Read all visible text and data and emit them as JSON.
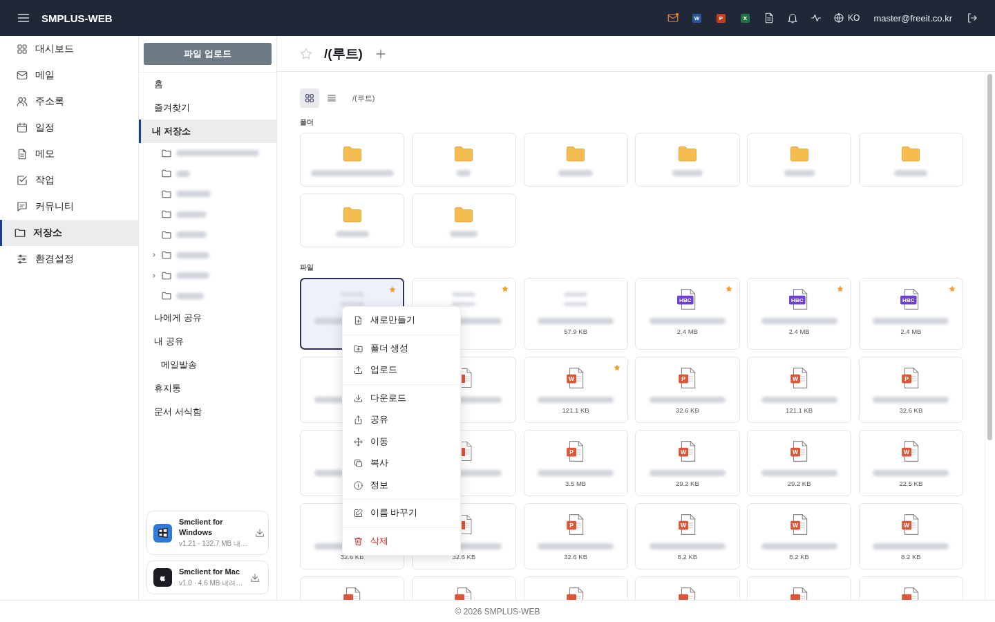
{
  "top_bar": {
    "app_name": "SMPLUS-WEB",
    "office_apps": [
      {
        "letter": "W",
        "color": "#2b579a"
      },
      {
        "letter": "P",
        "color": "#c43e1c"
      },
      {
        "letter": "X",
        "color": "#217346"
      }
    ],
    "language": "KO",
    "user": "master@freeit.co.kr"
  },
  "nav": [
    {
      "label": "대시보드",
      "selected": false
    },
    {
      "label": "메일",
      "selected": false
    },
    {
      "label": "주소록",
      "selected": false
    },
    {
      "label": "일정",
      "selected": false
    },
    {
      "label": "메모",
      "selected": false
    },
    {
      "label": "작업",
      "selected": false
    },
    {
      "label": "커뮤니티",
      "selected": false
    },
    {
      "label": "저장소",
      "selected": true
    },
    {
      "label": "환경설정",
      "selected": false
    }
  ],
  "storage_sidebar": {
    "upload_button": "파일 업로드",
    "items": [
      {
        "label": "홈",
        "selected": false
      },
      {
        "label": "즐겨찾기",
        "selected": false
      },
      {
        "label": "내 저장소",
        "selected": true,
        "children": [
          {
            "expandable": false
          },
          {
            "expandable": false
          },
          {
            "expandable": false
          },
          {
            "expandable": false
          },
          {
            "expandable": false
          },
          {
            "expandable": true
          },
          {
            "expandable": true
          },
          {
            "expandable": false
          }
        ]
      },
      {
        "label": "나에게 공유",
        "selected": false
      },
      {
        "label": "내 공유",
        "selected": false,
        "children": [
          {
            "label": "메일발송",
            "selected": false
          }
        ]
      },
      {
        "label": "휴지통",
        "selected": false
      },
      {
        "label": "문서 서식함",
        "selected": false
      }
    ],
    "apps": [
      {
        "kind": "windows",
        "name": "Smclient for Windows",
        "info": "v1.21 · 132.7 MB 내…"
      },
      {
        "kind": "mac",
        "name": "Smclient for Mac",
        "info": "v1.0 · 4.6 MB 내려…"
      }
    ]
  },
  "header": {
    "title": "/(루트)",
    "favorite": false
  },
  "toolbar": {
    "views": [
      {
        "kind": "grid",
        "selected": true
      },
      {
        "kind": "list",
        "selected": false
      }
    ],
    "breadcrumb": "/(루트)"
  },
  "folders": {
    "heading": "폴더",
    "items": [
      {
        "kind": "folder"
      },
      {
        "kind": "folder"
      },
      {
        "kind": "folder"
      },
      {
        "kind": "folder"
      },
      {
        "kind": "folder"
      },
      {
        "kind": "folder"
      },
      {
        "kind": "folder"
      },
      {
        "kind": "folder"
      }
    ]
  },
  "files": {
    "heading": "파일",
    "items": [
      {
        "kind": "image",
        "starred": true,
        "selected": true
      },
      {
        "kind": "image",
        "starred": true,
        "selected": false
      },
      {
        "kind": "image",
        "starred": false,
        "selected": false,
        "size": "57.9 KB"
      },
      {
        "kind": "hbc",
        "badge": "HBC",
        "starred": true,
        "selected": false,
        "size": "2.4 MB"
      },
      {
        "kind": "hbc",
        "badge": "HBC",
        "starred": true,
        "selected": false,
        "size": "2.4 MB"
      },
      {
        "kind": "hbc",
        "badge": "HBC",
        "starred": true,
        "selected": false,
        "size": "2.4 MB"
      },
      {
        "kind": "covered",
        "starred": false,
        "selected": false
      },
      {
        "kind": "doc-partial",
        "starred": false,
        "selected": false
      },
      {
        "kind": "doc",
        "badge": "W",
        "starred": true,
        "selected": false,
        "size": "121.1 KB"
      },
      {
        "kind": "doc",
        "badge": "P",
        "starred": false,
        "selected": false,
        "size": "32.6 KB"
      },
      {
        "kind": "doc",
        "badge": "W",
        "starred": false,
        "selected": false,
        "size": "121.1 KB"
      },
      {
        "kind": "doc",
        "badge": "P",
        "starred": false,
        "selected": false,
        "size": "32.6 KB"
      },
      {
        "kind": "covered",
        "starred": false,
        "selected": false
      },
      {
        "kind": "doc-partial",
        "starred": false,
        "selected": false
      },
      {
        "kind": "doc",
        "badge": "P",
        "starred": false,
        "selected": false,
        "size": "3.5 MB"
      },
      {
        "kind": "doc",
        "badge": "W",
        "starred": false,
        "selected": false,
        "size": "29.2 KB"
      },
      {
        "kind": "doc",
        "badge": "W",
        "starred": false,
        "selected": false,
        "size": "29.2 KB"
      },
      {
        "kind": "doc",
        "badge": "W",
        "starred": false,
        "selected": false,
        "size": "22.5 KB"
      },
      {
        "kind": "covered",
        "starred": false,
        "selected": false,
        "size": "32.6 KB"
      },
      {
        "kind": "doc-partial",
        "starred": false,
        "selected": false,
        "size": "32.6 KB"
      },
      {
        "kind": "doc",
        "badge": "P",
        "starred": false,
        "selected": false,
        "size": "32.6 KB"
      },
      {
        "kind": "doc",
        "badge": "W",
        "starred": false,
        "selected": false,
        "size": "8.2 KB"
      },
      {
        "kind": "doc",
        "badge": "W",
        "starred": false,
        "selected": false,
        "size": "8.2 KB"
      },
      {
        "kind": "doc",
        "badge": "W",
        "starred": false,
        "selected": false,
        "size": "8.2 KB"
      },
      {
        "kind": "doc",
        "starred": false,
        "selected": false
      },
      {
        "kind": "doc",
        "starred": false,
        "selected": false
      },
      {
        "kind": "doc",
        "starred": false,
        "selected": false
      },
      {
        "kind": "doc",
        "starred": false,
        "selected": false
      },
      {
        "kind": "doc",
        "starred": false,
        "selected": false
      },
      {
        "kind": "doc",
        "starred": false,
        "selected": false
      }
    ]
  },
  "context_menu": {
    "groups": [
      [
        {
          "label": "새로만들기",
          "kind": "normal"
        }
      ],
      [
        {
          "label": "폴더 생성",
          "kind": "normal"
        },
        {
          "label": "업로드",
          "kind": "normal"
        }
      ],
      [
        {
          "label": "다운로드",
          "kind": "normal"
        },
        {
          "label": "공유",
          "kind": "normal"
        },
        {
          "label": "이동",
          "kind": "normal"
        },
        {
          "label": "복사",
          "kind": "normal"
        },
        {
          "label": "정보",
          "kind": "normal"
        }
      ],
      [
        {
          "label": "이름 바꾸기",
          "kind": "normal"
        }
      ],
      [
        {
          "label": "삭제",
          "kind": "danger"
        }
      ]
    ]
  },
  "footer": "© 2026 SMPLUS-WEB"
}
